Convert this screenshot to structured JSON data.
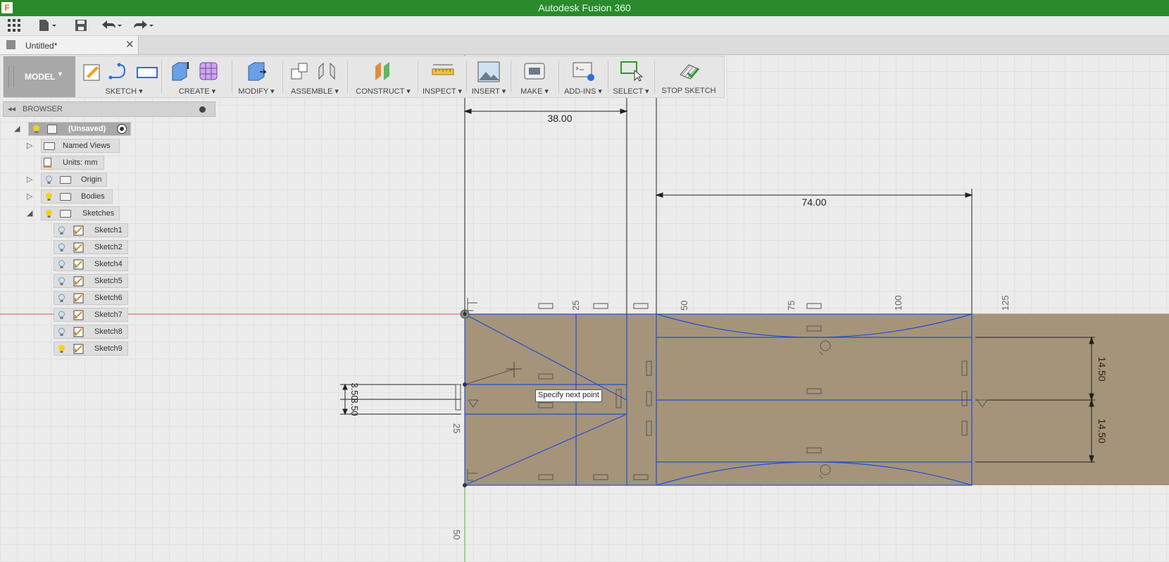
{
  "app": {
    "title": "Autodesk Fusion 360",
    "logo_letter": "F",
    "colors": {
      "titlebar": "#2b8a2b",
      "sketch_fill": "#a59479",
      "sketch_line": "#1f4fd6",
      "axis_x": "#e04040",
      "axis_y": "#3cba3c"
    }
  },
  "quick_access": {
    "icons": [
      "app-grid-icon",
      "file-menu-icon",
      "save-icon",
      "undo-icon",
      "redo-icon"
    ]
  },
  "document_tab": {
    "title": "Untitled*",
    "close_symbol": "✕"
  },
  "toolbar": {
    "workspace": "MODEL",
    "groups": [
      {
        "label": "SKETCH"
      },
      {
        "label": "CREATE"
      },
      {
        "label": "MODIFY"
      },
      {
        "label": "ASSEMBLE"
      },
      {
        "label": "CONSTRUCT"
      },
      {
        "label": "INSPECT"
      },
      {
        "label": "INSERT"
      },
      {
        "label": "MAKE"
      },
      {
        "label": "ADD-INS"
      },
      {
        "label": "SELECT"
      },
      {
        "label": "STOP SKETCH"
      }
    ]
  },
  "browser": {
    "header": "BROWSER",
    "root": "(Unsaved)",
    "items": {
      "named_views": "Named Views",
      "units": "Units: mm",
      "origin": "Origin",
      "bodies": "Bodies",
      "sketches": "Sketches"
    },
    "sketches": [
      "Sketch1",
      "Sketch2",
      "Sketch4",
      "Sketch5",
      "Sketch6",
      "Sketch7",
      "Sketch8",
      "Sketch9"
    ],
    "active_sketch": "Sketch9"
  },
  "canvas": {
    "dimensions": {
      "top_width": "38.00",
      "right_width": "74.00",
      "height_upper": "14.50",
      "height_lower": "14.50",
      "small_a": "3.50",
      "small_b": "3.50"
    },
    "ruler_labels": {
      "x_25": "25",
      "x_50": "50",
      "x_75": "75",
      "x_100": "100",
      "x_125": "125",
      "y_25": "25",
      "y_50": "50"
    },
    "tooltip": "Specify next point"
  }
}
